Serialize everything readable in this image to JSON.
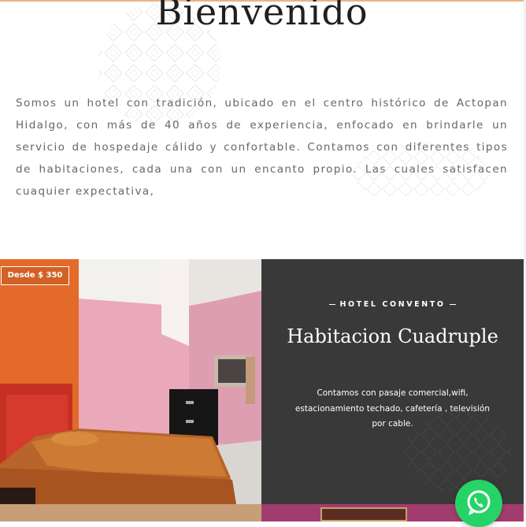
{
  "welcome": {
    "title": "Bienvenido",
    "intro": "Somos un hotel con tradición, ubicado en el centro histórico de Actopan Hidalgo, con más de 40 años de experiencia, enfocado en brindarle un servicio de hospedaje cálido y confortable. Contamos con diferentes tipos de habitaciones, cada una con un encanto propio. Las cuales satisfacen cuaquier expectativa,"
  },
  "room": {
    "price_badge": "Desde $ 350",
    "hotel_name": "HOTEL CONVENTO",
    "title": "Habitacion Cuadruple",
    "description": "Contamos con pasaje comercial,wifi, estacionamiento techado, cafetería , televisión por cable."
  },
  "floating": {
    "icon": "whatsapp-icon"
  },
  "colors": {
    "panel_bg": "#393939",
    "whatsapp_green": "#25d366",
    "text_gray": "#666666",
    "title_dark": "#1f1f1f"
  }
}
